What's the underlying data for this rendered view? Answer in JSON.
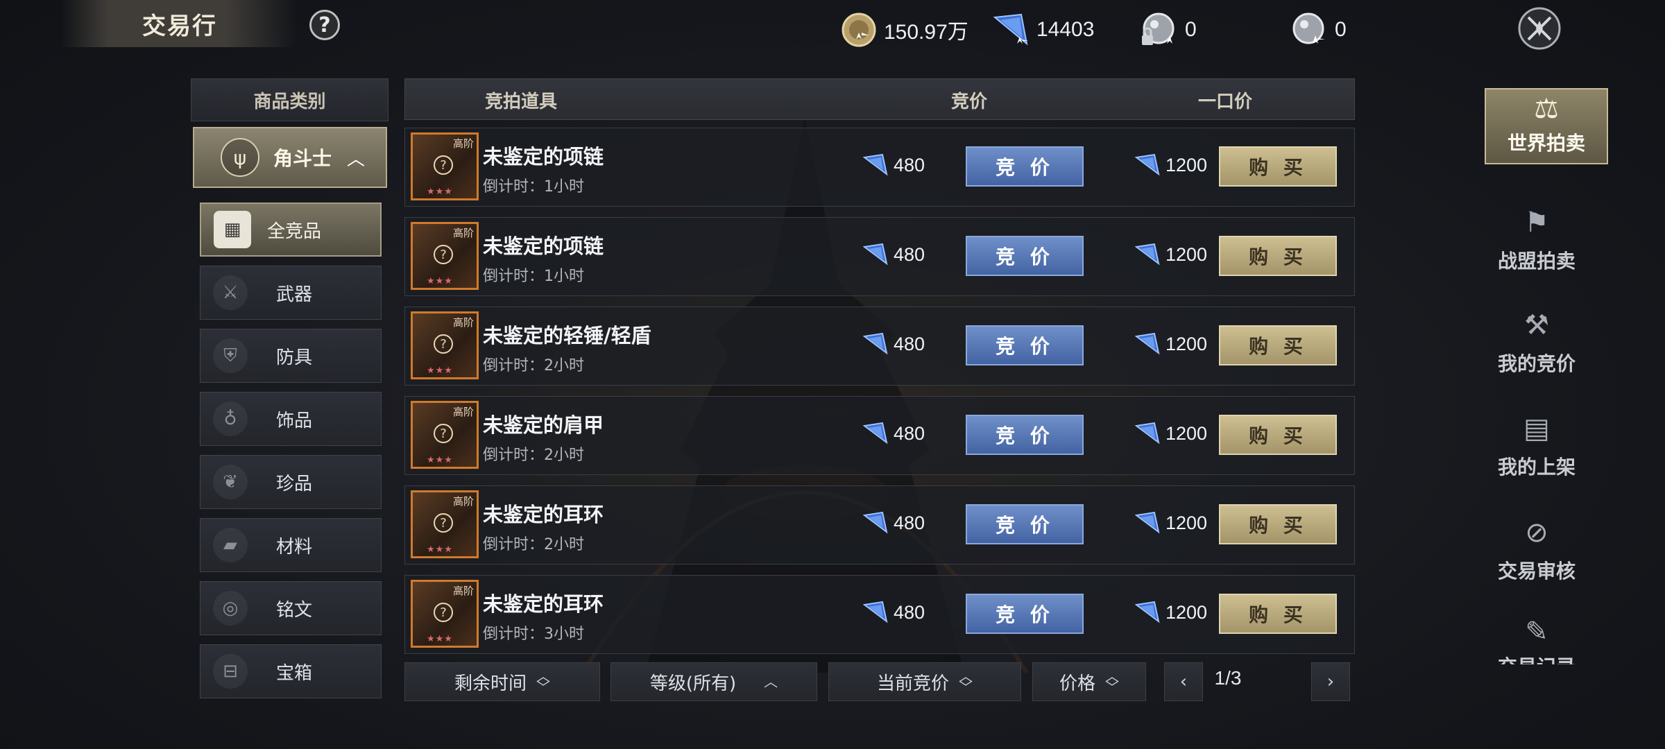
{
  "header": {
    "title": "交易行",
    "help_label": "?"
  },
  "currencies": [
    {
      "icon": "gold-coin-icon",
      "value": "150.97万"
    },
    {
      "icon": "blue-diamond-icon",
      "value": "14403"
    },
    {
      "icon": "locked-silver-orb-icon",
      "value": "0"
    },
    {
      "icon": "silver-orb-icon",
      "value": "0"
    }
  ],
  "categories": {
    "header": "商品类别",
    "group": {
      "label": "角斗士",
      "icon": "trident-icon"
    },
    "items": [
      {
        "label": "全竞品",
        "icon": "grid-icon",
        "active": true
      },
      {
        "label": "武器",
        "icon": "sword-icon",
        "active": false
      },
      {
        "label": "防具",
        "icon": "armor-icon",
        "active": false
      },
      {
        "label": "饰品",
        "icon": "amulet-icon",
        "active": false
      },
      {
        "label": "珍品",
        "icon": "leaf-gem-icon",
        "active": false
      },
      {
        "label": "材料",
        "icon": "book-icon",
        "active": false
      },
      {
        "label": "铭文",
        "icon": "rune-icon",
        "active": false
      },
      {
        "label": "宝箱",
        "icon": "chest-icon",
        "active": false
      }
    ]
  },
  "table": {
    "col_item": "竞拍道具",
    "col_bid": "竞价",
    "col_buyout": "一口价",
    "bid_button": "竞 价",
    "buy_button": "购 买",
    "rows": [
      {
        "name": "未鉴定的项链",
        "time": "倒计时：1小时",
        "grade": "高阶",
        "bid": "480",
        "buyout": "1200"
      },
      {
        "name": "未鉴定的项链",
        "time": "倒计时：1小时",
        "grade": "高阶",
        "bid": "480",
        "buyout": "1200"
      },
      {
        "name": "未鉴定的轻锤/轻盾",
        "time": "倒计时：2小时",
        "grade": "高阶",
        "bid": "480",
        "buyout": "1200"
      },
      {
        "name": "未鉴定的肩甲",
        "time": "倒计时：2小时",
        "grade": "高阶",
        "bid": "480",
        "buyout": "1200"
      },
      {
        "name": "未鉴定的耳环",
        "time": "倒计时：2小时",
        "grade": "高阶",
        "bid": "480",
        "buyout": "1200"
      },
      {
        "name": "未鉴定的耳环",
        "time": "倒计时：3小时",
        "grade": "高阶",
        "bid": "480",
        "buyout": "1200"
      }
    ]
  },
  "sort_bar": {
    "remaining_time": "剩余时间",
    "level": "等级(所有)",
    "current_bid": "当前竞价",
    "price": "价格",
    "page": "1/3"
  },
  "right_nav": [
    {
      "label": "世界拍卖",
      "icon": "scales-icon",
      "active": true
    },
    {
      "label": "战盟拍卖",
      "icon": "banner-icon",
      "active": false
    },
    {
      "label": "我的竞价",
      "icon": "gavel-icon",
      "active": false
    },
    {
      "label": "我的上架",
      "icon": "shelf-icon",
      "active": false
    },
    {
      "label": "交易审核",
      "icon": "stamp-icon",
      "active": false
    },
    {
      "label": "交易记录",
      "icon": "record-icon",
      "active": false
    }
  ],
  "colors": {
    "bid_button": "#5877b8",
    "buy_button": "#bfae80",
    "item_frame": "#d17a2a",
    "active_gold": "#8e8568"
  }
}
